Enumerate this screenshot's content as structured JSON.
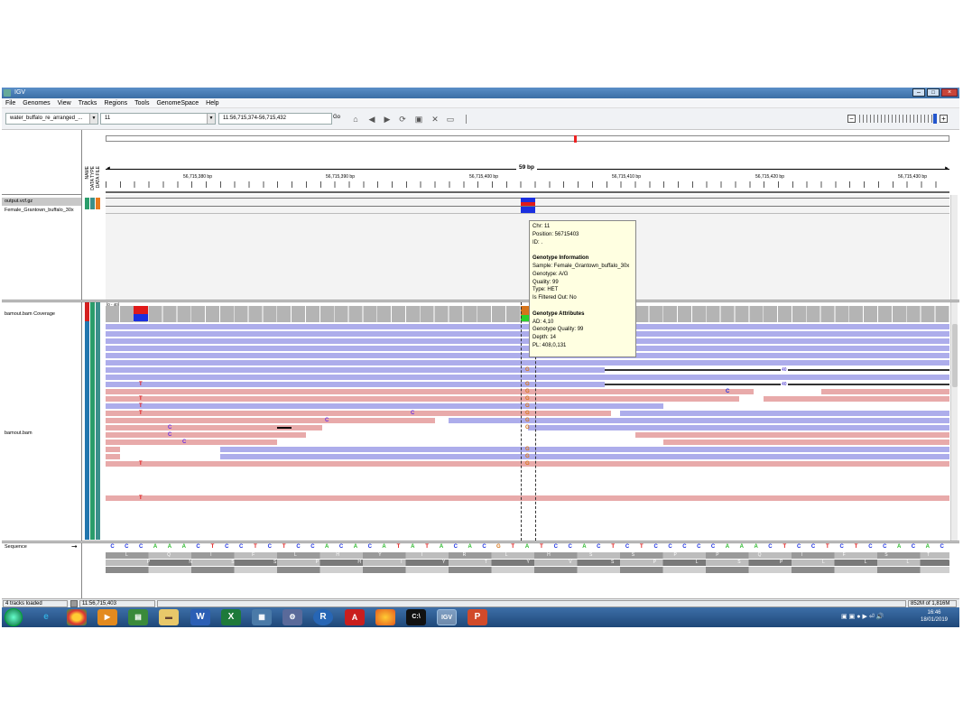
{
  "window": {
    "title": "IGV"
  },
  "menu": [
    "File",
    "Genomes",
    "View",
    "Tracks",
    "Regions",
    "Tools",
    "GenomeSpace",
    "Help"
  ],
  "toolbar": {
    "genome": "water_buffalo_re_arranged_...",
    "chromosome": "11",
    "locus": "11:56,715,374-56,715,432",
    "go": "Go"
  },
  "ruler": {
    "span": "59 bp",
    "ticks": [
      "56,715,380 bp",
      "56,715,390 bp",
      "56,715,400 bp",
      "56,715,410 bp",
      "56,715,420 bp",
      "56,715,430 bp"
    ]
  },
  "attr_header": [
    "NAME",
    "DATA TYPE",
    "DATA FILE"
  ],
  "tracks": {
    "vcf": "output.vcf.gz",
    "sample": "Female_Grantown_buffalo_30x",
    "coverage": "bamout.bam Coverage",
    "coverage_range": "[0 - 40]",
    "bam": "bamout.bam",
    "sequence": "Sequence"
  },
  "tooltip": {
    "chr": "Chr: 11",
    "position": "Position: 56715403",
    "id": "ID: .",
    "gt_header": "Genotype Information",
    "sample": "Sample: Female_Grantown_buffalo_30x",
    "genotype": "Genotype: A/G",
    "quality": "Quality: 99",
    "type": "Type: HET",
    "filtered": "Is Filtered Out: No",
    "attr_header": "Genotype Attributes",
    "ad": "AD: 4,10",
    "gq": "Genotype Quality: 99",
    "depth": "Depth: 14",
    "pl": "PL: 408,0,131"
  },
  "insert_label": "40",
  "sequence": "CCCAAACTCCTCTCCACACATATACACGTATCCACTCTCCCCCAAACTCCTCTCCACAC",
  "amino": [
    "L",
    "Q",
    "I",
    "F",
    "L",
    "H",
    "Y",
    "I",
    "R",
    "L",
    "H",
    "S",
    "S",
    "P",
    "P",
    "Q",
    "I",
    "F",
    "S",
    "T"
  ],
  "amino2": [
    "P",
    "N",
    "S",
    "S",
    "P",
    "H",
    "I",
    "Y",
    "T",
    "Y",
    "V",
    "S",
    "P",
    "L",
    "S",
    "P",
    "L",
    "L",
    "L",
    "T"
  ],
  "status": {
    "tracks_loaded": "4 tracks loaded",
    "position": "11:56,715,403",
    "memory": "852M of 1,816M"
  },
  "clock": {
    "time": "16:46",
    "date": "18/01/2019"
  }
}
